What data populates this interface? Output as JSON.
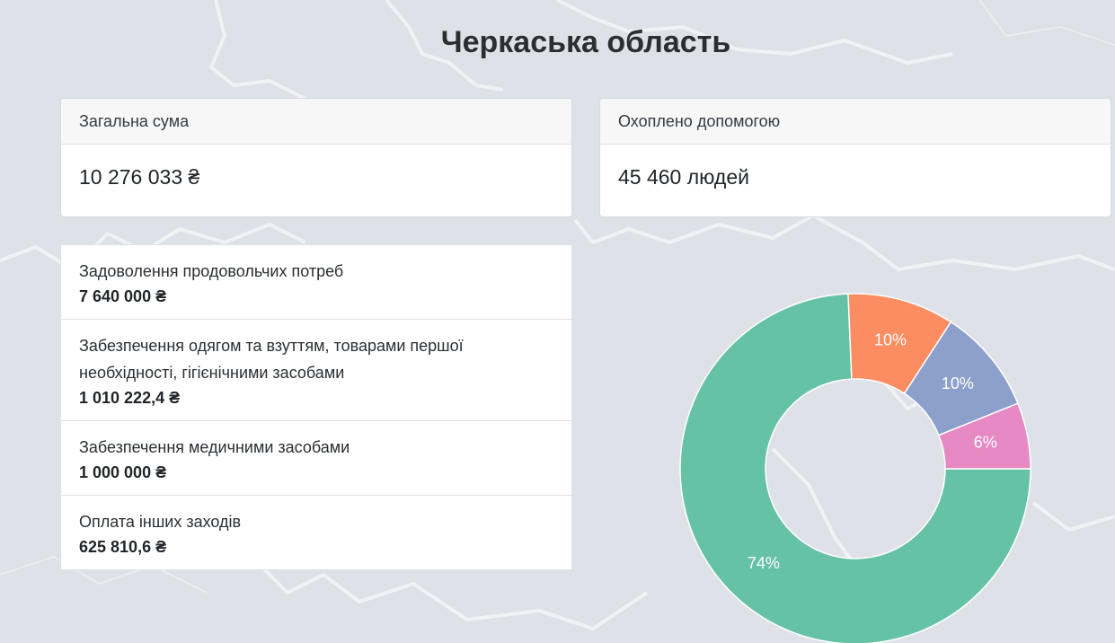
{
  "header": {
    "title": "Черкаська область"
  },
  "cards": {
    "total": {
      "label": "Загальна сума",
      "value": "10 276 033 ₴"
    },
    "covered": {
      "label": "Охоплено допомогою",
      "value": "45 460 людей"
    }
  },
  "items": [
    {
      "label": "Задоволення продовольчих потреб",
      "amount": "7 640 000 ₴"
    },
    {
      "label": "Забезпечення одягом та взуттям, товарами першої необхідності, гігієнічними засобами",
      "amount": "1 010 222,4 ₴"
    },
    {
      "label": "Забезпечення медичними засобами",
      "amount": "1 000 000 ₴"
    },
    {
      "label": "Оплата інших заходів",
      "amount": "625 810,6 ₴"
    }
  ],
  "chart_data": {
    "type": "pie",
    "style": "donut",
    "categories": [
      "Задоволення продовольчих потреб",
      "Забезпечення одягом та взуттям, товарами першої необхідності, гігієнічними засобами",
      "Забезпечення медичними засобами",
      "Оплата інших заходів"
    ],
    "values": [
      7640000,
      1010222.4,
      1000000,
      625810.6
    ],
    "labels": [
      "74%",
      "10%",
      "10%",
      "6%"
    ],
    "colors": [
      "#66c2a5",
      "#fc8d62",
      "#8da0cb",
      "#e78ac3"
    ]
  }
}
